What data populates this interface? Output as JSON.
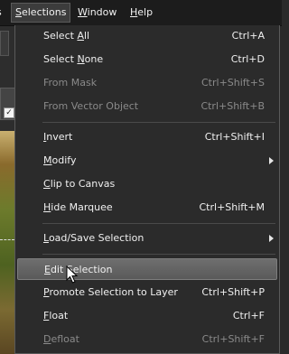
{
  "menubar": {
    "partial_left": "s",
    "selections": {
      "pre": "",
      "acc": "S",
      "post": "elections"
    },
    "window": {
      "pre": "",
      "acc": "W",
      "post": "indow"
    },
    "help": {
      "pre": "",
      "acc": "H",
      "post": "elp"
    }
  },
  "menu": {
    "select_all": {
      "pre": "Select ",
      "acc": "A",
      "post": "ll",
      "shortcut": "Ctrl+A"
    },
    "select_none": {
      "pre": "Select ",
      "acc": "N",
      "post": "one",
      "shortcut": "Ctrl+D"
    },
    "from_mask": {
      "label": "From Mask",
      "shortcut": "Ctrl+Shift+S"
    },
    "from_vector": {
      "label": "From Vector Object",
      "shortcut": "Ctrl+Shift+B"
    },
    "invert": {
      "pre": "",
      "acc": "I",
      "post": "nvert",
      "shortcut": "Ctrl+Shift+I"
    },
    "modify": {
      "pre": "",
      "acc": "M",
      "post": "odify"
    },
    "clip": {
      "pre": "",
      "acc": "C",
      "post": "lip to Canvas"
    },
    "hide": {
      "pre": "",
      "acc": "H",
      "post": "ide Marquee",
      "shortcut": "Ctrl+Shift+M"
    },
    "loadsave": {
      "pre": "",
      "acc": "L",
      "post": "oad/Save Selection"
    },
    "edit": {
      "pre": "",
      "acc": "E",
      "post": "dit Selection"
    },
    "promote": {
      "pre": "",
      "acc": "P",
      "post": "romote Selection to Layer",
      "shortcut": "Ctrl+Shift+P"
    },
    "float": {
      "pre": "",
      "acc": "F",
      "post": "loat",
      "shortcut": "Ctrl+F"
    },
    "defloat": {
      "pre": "",
      "acc": "D",
      "post": "efloat",
      "shortcut": "Ctrl+Shift+F"
    }
  },
  "icons": {
    "submenu": "chevron-right-icon",
    "cursor": "mouse-pointer-icon",
    "checkbox": "checkmark-icon"
  },
  "colors": {
    "menu_bg": "#2b2b2b",
    "highlight": "#646464",
    "disabled_text": "#8a8a8a",
    "text": "#f0f0f0"
  }
}
